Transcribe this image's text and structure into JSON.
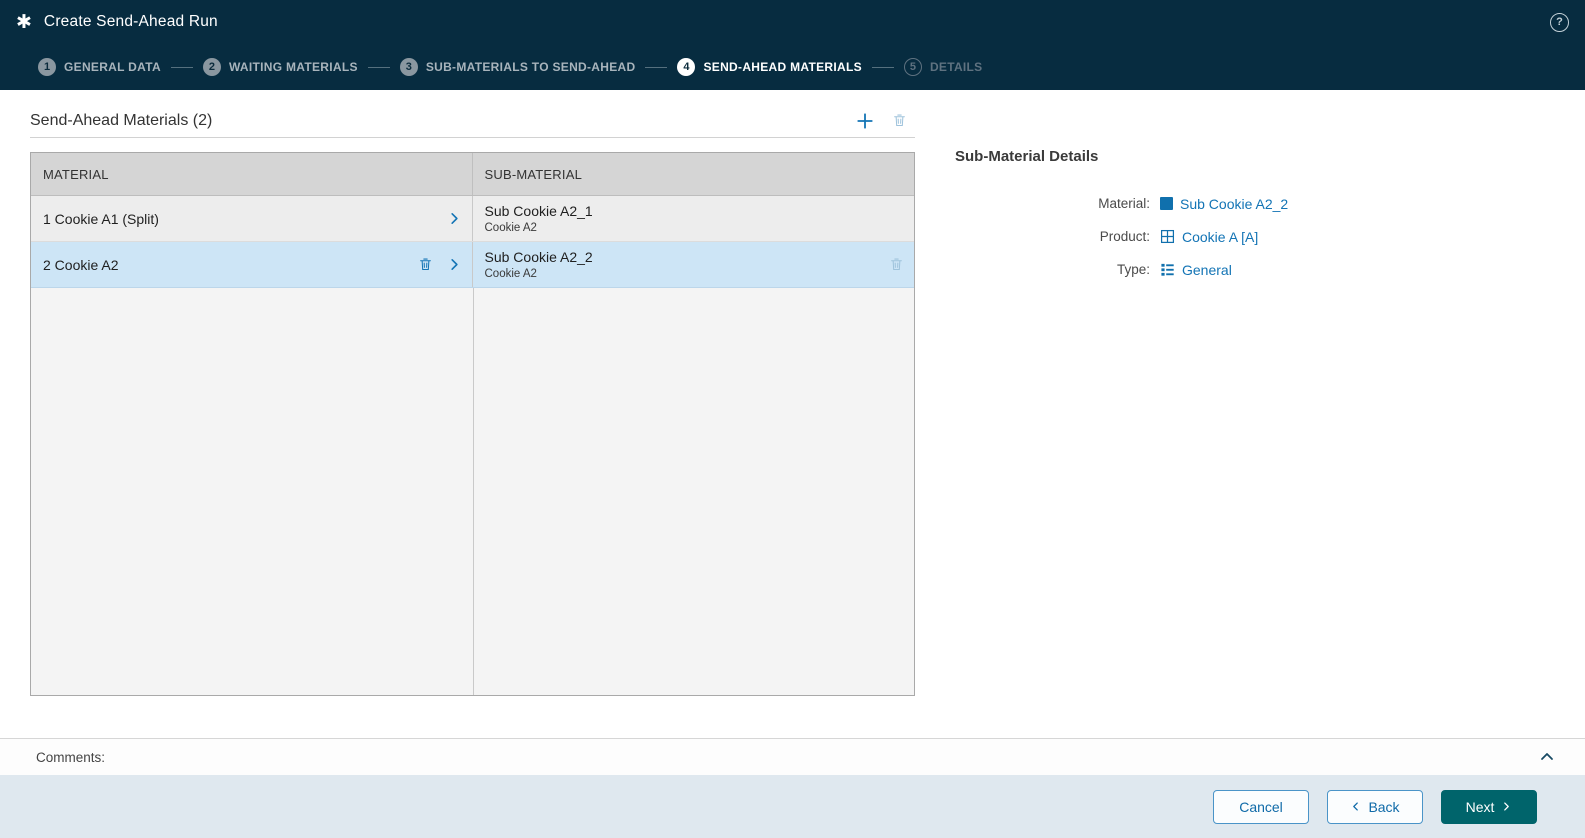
{
  "colors": {
    "header_bg": "#072c40",
    "accent_blue": "#1374b5",
    "selected_row": "#cde5f6",
    "next_button_bg": "#00646b"
  },
  "header": {
    "title": "Create Send-Ahead Run"
  },
  "wizard": {
    "steps": [
      {
        "number": "1",
        "label": "GENERAL DATA",
        "state": "completed"
      },
      {
        "number": "2",
        "label": "WAITING MATERIALS",
        "state": "completed"
      },
      {
        "number": "3",
        "label": "SUB-MATERIALS TO SEND-AHEAD",
        "state": "completed"
      },
      {
        "number": "4",
        "label": "SEND-AHEAD MATERIALS",
        "state": "active"
      },
      {
        "number": "5",
        "label": "DETAILS",
        "state": "upcoming"
      }
    ]
  },
  "main": {
    "section_title": "Send-Ahead Materials (2)",
    "table": {
      "columns": [
        "MATERIAL",
        "SUB-MATERIAL"
      ],
      "rows": [
        {
          "material": "1 Cookie A1 (Split)",
          "sub_material": "Sub Cookie A2_1",
          "sub_material_parent": "Cookie A2",
          "selected": false
        },
        {
          "material": "2 Cookie A2",
          "sub_material": "Sub Cookie A2_2",
          "sub_material_parent": "Cookie A2",
          "selected": true
        }
      ]
    }
  },
  "details_panel": {
    "title": "Sub-Material Details",
    "fields": [
      {
        "label": "Material:",
        "value": "Sub Cookie A2_2"
      },
      {
        "label": "Product:",
        "value": "Cookie A [A]"
      },
      {
        "label": "Type:",
        "value": "General"
      }
    ]
  },
  "comments": {
    "label": "Comments:"
  },
  "footer": {
    "cancel_label": "Cancel",
    "back_label": "Back",
    "next_label": "Next"
  }
}
